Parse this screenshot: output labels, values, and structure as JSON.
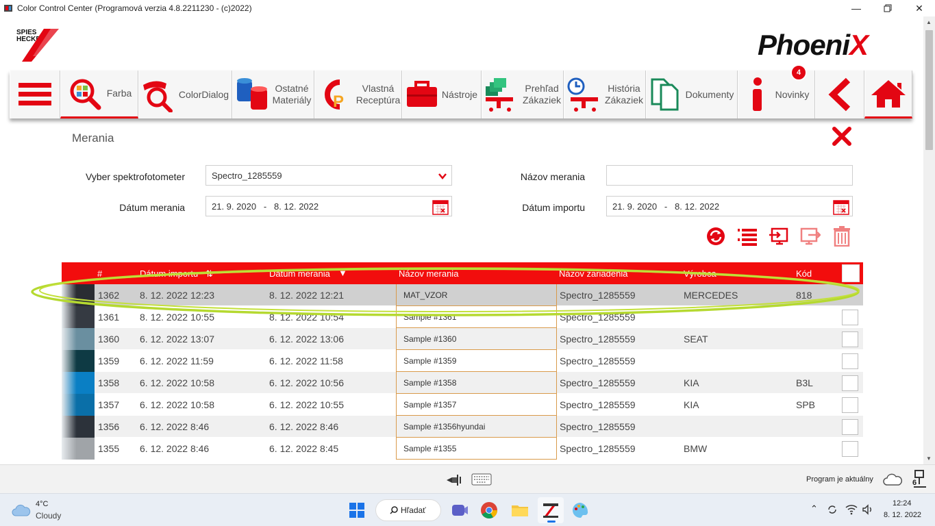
{
  "window": {
    "title": "Color Control Center (Programová verzia 4.8.2211230 - (c)2022)"
  },
  "header": {
    "brand_left_line1": "SPIES",
    "brand_left_line2": "HECKER",
    "brand_right": "Phoeni",
    "brand_right_x": "X"
  },
  "toolbar": {
    "items": [
      {
        "label": "",
        "icon": "menu-icon"
      },
      {
        "label": "Farba",
        "icon": "color-search-icon"
      },
      {
        "label": "ColorDialog",
        "icon": "color-dialog-icon"
      },
      {
        "label": "Ostatné Materiály",
        "icon": "materials-icon"
      },
      {
        "label": "Vlastná Receptúra",
        "icon": "own-recipe-icon"
      },
      {
        "label": "Nástroje",
        "icon": "toolbox-icon"
      },
      {
        "label": "Prehľad Zákaziek",
        "icon": "orders-overview-icon"
      },
      {
        "label": "História Zákaziek",
        "icon": "orders-history-icon"
      },
      {
        "label": "Dokumenty",
        "icon": "documents-icon"
      },
      {
        "label": "Novinky",
        "icon": "info-icon",
        "badge": "4"
      },
      {
        "label": "",
        "icon": "back-icon"
      },
      {
        "label": "",
        "icon": "home-icon"
      }
    ],
    "accent": "#e30613"
  },
  "section": {
    "title": "Merania"
  },
  "filters": {
    "spectro_label": "Vyber spektrofotometer",
    "spectro_value": "Spectro_1285559",
    "name_label": "Názov merania",
    "name_value": "",
    "measure_date_label": "Dátum merania",
    "measure_date_value": "21. 9. 2020   -   8. 12. 2022",
    "import_date_label": "Dátum importu",
    "import_date_value": "21. 9. 2020   -   8. 12. 2022"
  },
  "table": {
    "headers": {
      "num": "#",
      "import_date": "Dátum importu",
      "measure_date": "Dátum merania",
      "name": "Názov merania",
      "device": "Názov zariadenia",
      "maker": "Výrobca",
      "code": "Kód"
    },
    "rows": [
      {
        "num": "1362",
        "import": "8. 12. 2022 12:23",
        "measure": "8. 12. 2022 12:21",
        "name": "MAT_VZOR",
        "device": "Spectro_1285559",
        "maker": "MERCEDES",
        "code": "818",
        "swatch": "#2a2d33"
      },
      {
        "num": "1361",
        "import": "8. 12. 2022 10:55",
        "measure": "8. 12. 2022 10:54",
        "name": "Sample #1361",
        "device": "Spectro_1285559",
        "maker": "",
        "code": "",
        "swatch": "#353a42"
      },
      {
        "num": "1360",
        "import": "6. 12. 2022 13:07",
        "measure": "6. 12. 2022 13:06",
        "name": "Sample #1360",
        "device": "Spectro_1285559",
        "maker": "SEAT",
        "code": "",
        "swatch": "#6a8fa0"
      },
      {
        "num": "1359",
        "import": "6. 12. 2022 11:59",
        "measure": "6. 12. 2022 11:58",
        "name": "Sample #1359",
        "device": "Spectro_1285559",
        "maker": "",
        "code": "",
        "swatch": "#0e3a44"
      },
      {
        "num": "1358",
        "import": "6. 12. 2022 10:58",
        "measure": "6. 12. 2022 10:56",
        "name": "Sample #1358",
        "device": "Spectro_1285559",
        "maker": "KIA",
        "code": "B3L",
        "swatch": "#0a7fc4"
      },
      {
        "num": "1357",
        "import": "6. 12. 2022 10:58",
        "measure": "6. 12. 2022 10:55",
        "name": "Sample #1357",
        "device": "Spectro_1285559",
        "maker": "KIA",
        "code": "SPB",
        "swatch": "#0a6fa8"
      },
      {
        "num": "1356",
        "import": "6. 12. 2022 8:46",
        "measure": "6. 12. 2022 8:46",
        "name": "Sample #1356hyundai",
        "device": "Spectro_1285559",
        "maker": "",
        "code": "",
        "swatch": "#2c323a"
      },
      {
        "num": "1355",
        "import": "6. 12. 2022 8:46",
        "measure": "6. 12. 2022 8:45",
        "name": "Sample #1355",
        "device": "Spectro_1285559",
        "maker": "BMW",
        "code": "",
        "swatch": "#a0a4a8"
      }
    ]
  },
  "statusbar": {
    "text": "Program je aktuálny",
    "count": "6"
  },
  "taskbar": {
    "temp": "4°C",
    "condition": "Cloudy",
    "search": "Hľadať",
    "time": "12:24",
    "date": "8. 12. 2022"
  }
}
